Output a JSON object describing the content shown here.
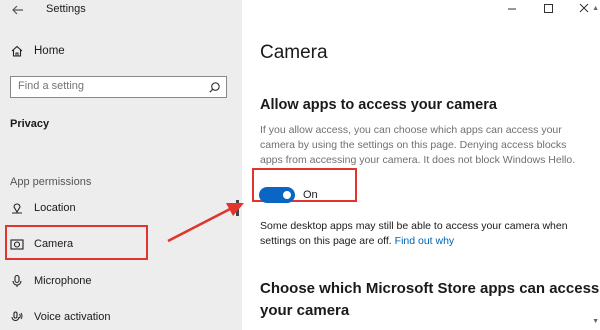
{
  "window": {
    "title": "Settings"
  },
  "sidebar": {
    "home_label": "Home",
    "search_placeholder": "Find a setting",
    "section_label": "Privacy",
    "group_label": "App permissions",
    "items": [
      {
        "label": "Location",
        "icon": "location-icon"
      },
      {
        "label": "Camera",
        "icon": "camera-icon",
        "selected": true
      },
      {
        "label": "Microphone",
        "icon": "microphone-icon"
      },
      {
        "label": "Voice activation",
        "icon": "voice-activation-icon"
      }
    ]
  },
  "main": {
    "heading": "Camera",
    "section_title": "Allow apps to access your camera",
    "description": "If you allow access, you can choose which apps can access your camera by using the settings on this page. Denying access blocks apps from accessing your camera. It does not block Windows Hello.",
    "toggle": {
      "state": "On",
      "on": true
    },
    "note_text": "Some desktop apps may still be able to access your camera when settings on this page are off. ",
    "note_link": "Find out why",
    "section_title_2": "Choose which Microsoft Store apps can access your camera"
  },
  "colors": {
    "accent": "#0a66c2",
    "link": "#0063b1",
    "highlight": "#e0342d",
    "sidebar_bg": "#ededed"
  }
}
